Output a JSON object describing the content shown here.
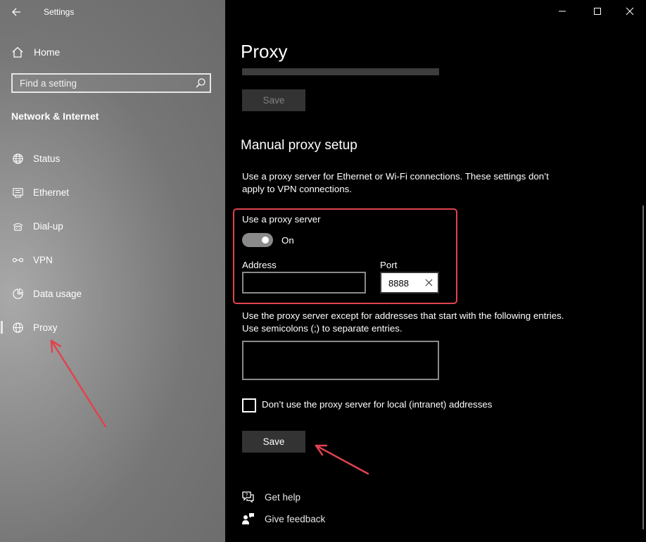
{
  "window": {
    "title": "Settings"
  },
  "sidebar": {
    "home_label": "Home",
    "search_placeholder": "Find a setting",
    "section_title": "Network & Internet",
    "items": [
      {
        "label": "Status",
        "icon": "globe-status-icon"
      },
      {
        "label": "Ethernet",
        "icon": "ethernet-icon"
      },
      {
        "label": "Dial-up",
        "icon": "dialup-icon"
      },
      {
        "label": "VPN",
        "icon": "vpn-icon"
      },
      {
        "label": "Data usage",
        "icon": "data-usage-icon"
      },
      {
        "label": "Proxy",
        "icon": "globe-icon",
        "selected": true
      }
    ]
  },
  "main": {
    "page_title": "Proxy",
    "top_save_label": "Save",
    "manual_heading": "Manual proxy setup",
    "manual_description": "Use a proxy server for Ethernet or Wi-Fi connections. These settings don’t apply to VPN connections.",
    "use_proxy_label": "Use a proxy server",
    "use_proxy_state": "On",
    "use_proxy_on": true,
    "address_label": "Address",
    "address_value": "",
    "port_label": "Port",
    "port_value": "8888",
    "exceptions_description": "Use the proxy server except for addresses that start with the following entries. Use semicolons (;) to separate entries.",
    "exceptions_value": "",
    "local_bypass_label": "Don’t use the proxy server for local (intranet) addresses",
    "local_bypass_checked": false,
    "save_label": "Save",
    "help_label": "Get help",
    "feedback_label": "Give feedback"
  },
  "colors": {
    "highlight_border": "#e0434f",
    "annotation_arrow": "#e0434f",
    "button_bg": "#333333"
  }
}
